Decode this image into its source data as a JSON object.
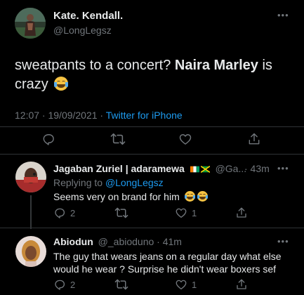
{
  "main_tweet": {
    "display_name": "Kate. Kendall.",
    "handle": "@LongLegsz",
    "text_part1": "sweatpants to a concert? ",
    "text_bold": "Naira Marley",
    "text_part2": " is",
    "text_line2": "crazy",
    "emoji": "face-with-tears-of-joy",
    "time": "12:07 · 19/09/2021 · ",
    "source": "Twitter for iPhone"
  },
  "replies": [
    {
      "display_name": "Jagaban Zuriel | adaramewa",
      "flags": [
        "ivory-coast-flag",
        "jamaica-flag"
      ],
      "handle": "@Ga...",
      "time": "· 43m",
      "replying_prefix": "Replying to ",
      "replying_to": "@LongLegsz",
      "text": "Seems very on brand for him",
      "emojis": [
        "face-with-tears-of-joy",
        "face-with-tears-of-joy"
      ],
      "reply_count": "2",
      "retweet_count": "",
      "like_count": "1"
    },
    {
      "display_name": "Abiodun",
      "handle": "@_abioduno",
      "time": "· 41m",
      "text_line1": "The guy that wears jeans on a regular day what else",
      "text_line2": "would he wear ? Surprise he didn't wear boxers sef",
      "reply_count": "2",
      "retweet_count": "",
      "like_count": "1"
    }
  ],
  "icons": {
    "more": "more-dots-icon",
    "reply": "reply-icon",
    "retweet": "retweet-icon",
    "like": "like-icon",
    "share": "share-icon"
  },
  "colors": {
    "background": "#000000",
    "link": "#1d9bf0",
    "muted": "#71767b",
    "text": "#e7e9ea",
    "divider": "#2f3336"
  }
}
